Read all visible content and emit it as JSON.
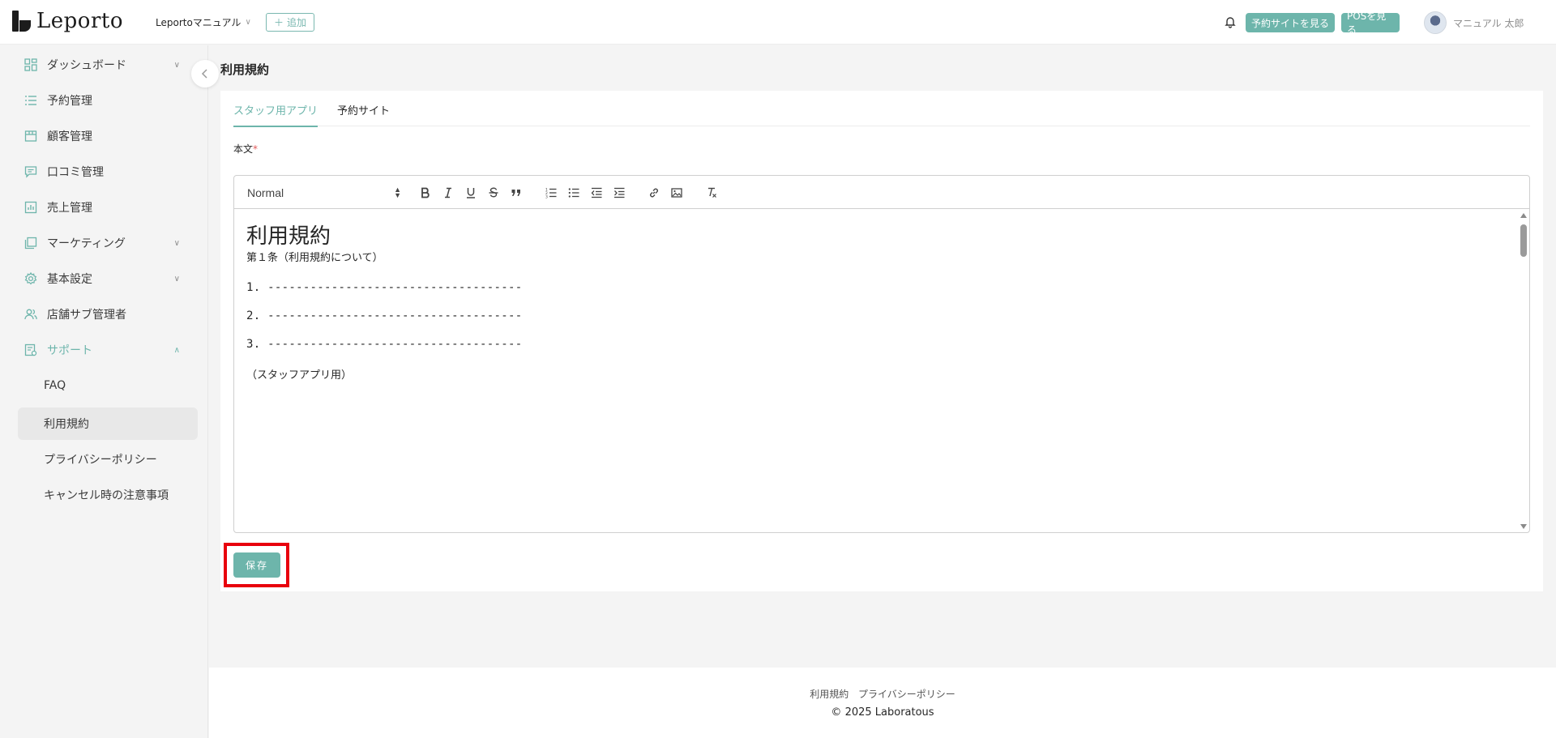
{
  "header": {
    "logo_text": "Leporto",
    "store_name": "Leportoマニュアル",
    "add_label": "追加",
    "booking_site_button": "予約サイトを見る",
    "pos_button": "POSを見る",
    "user_name": "マニュアル 太郎"
  },
  "sidebar": {
    "items": [
      {
        "label": "ダッシュボード",
        "icon": "dashboard-icon",
        "has_caret": true
      },
      {
        "label": "予約管理",
        "icon": "list-icon"
      },
      {
        "label": "顧客管理",
        "icon": "store-icon"
      },
      {
        "label": "口コミ管理",
        "icon": "review-icon"
      },
      {
        "label": "売上管理",
        "icon": "chart-icon"
      },
      {
        "label": "マーケティング",
        "icon": "marketing-icon",
        "has_caret": true
      },
      {
        "label": "基本設定",
        "icon": "gear-icon",
        "has_caret": true
      },
      {
        "label": "店舗サブ管理者",
        "icon": "users-icon"
      },
      {
        "label": "サポート",
        "icon": "support-icon",
        "has_caret": true,
        "expanded": true
      }
    ],
    "sub_items": [
      {
        "label": "FAQ"
      },
      {
        "label": "利用規約",
        "selected": true
      },
      {
        "label": "プライバシーポリシー"
      },
      {
        "label": "キャンセル時の注意事項"
      }
    ]
  },
  "main": {
    "page_title": "利用規約",
    "tabs": [
      {
        "label": "スタッフ用アプリ",
        "active": true
      },
      {
        "label": "予約サイト"
      }
    ],
    "field_label": "本文",
    "required_mark": "*",
    "editor": {
      "format_select": "Normal",
      "heading": "利用規約",
      "article": "第１条（利用規約について）",
      "lines": [
        "1. ------------------------------------",
        "2. ------------------------------------",
        "3. ------------------------------------"
      ],
      "note": "（スタッフアプリ用）"
    },
    "save_label": "保存"
  },
  "footer": {
    "terms_link": "利用規約",
    "privacy_link": "プライバシーポリシー",
    "copyright": "2025 Laboratous"
  },
  "colors": {
    "accent": "#6db5ab",
    "highlight": "#e8000d"
  }
}
